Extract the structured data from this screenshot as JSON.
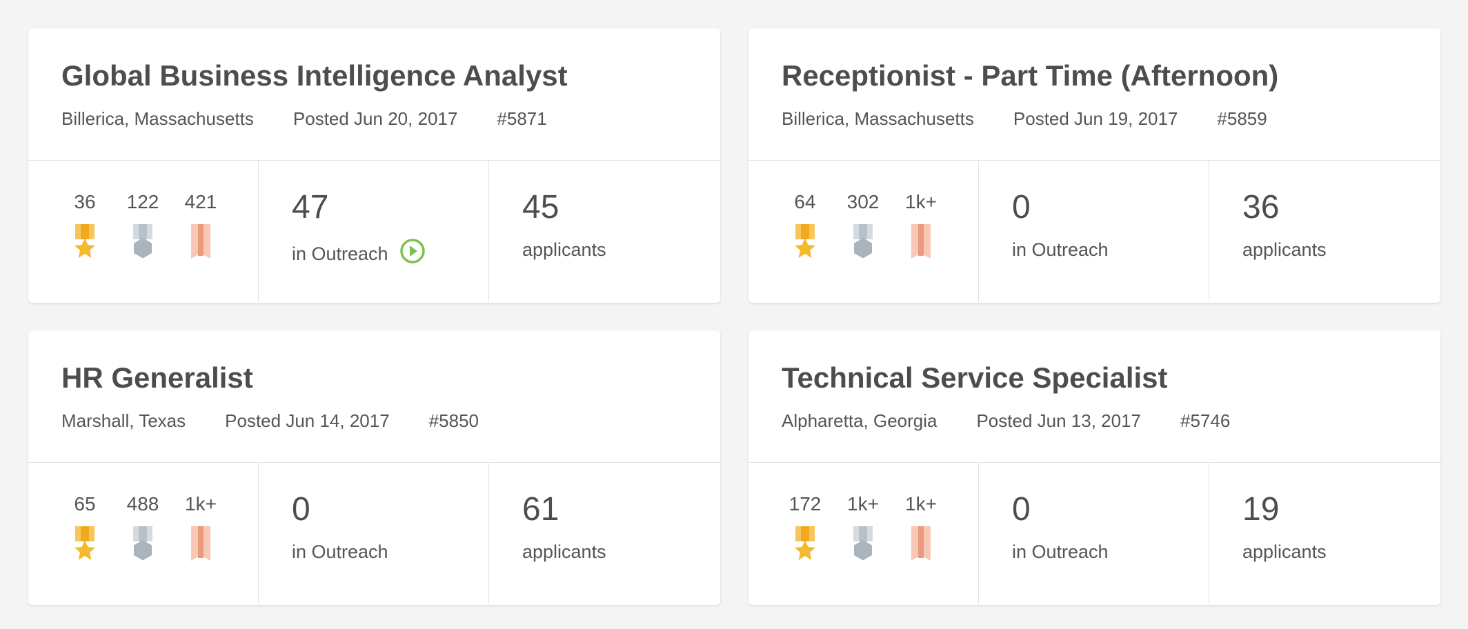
{
  "colors": {
    "background": "#f4f4f4",
    "card": "#ffffff",
    "gold": "#f5b92e",
    "silver": "#a9b4bd",
    "bronze": "#f0a990",
    "outreach_play": "#7cc14f"
  },
  "jobs": [
    {
      "title": "Global Business Intelligence Analyst",
      "location": "Billerica, Massachusetts",
      "posted": "Posted Jun 20, 2017",
      "id": "#5871",
      "medals": {
        "gold": "36",
        "silver": "122",
        "bronze": "421"
      },
      "outreach_count": "47",
      "outreach_label": "in Outreach",
      "outreach_active": true,
      "applicants_count": "45",
      "applicants_label": "applicants"
    },
    {
      "title": "Receptionist - Part Time (Afternoon)",
      "location": "Billerica, Massachusetts",
      "posted": "Posted Jun 19, 2017",
      "id": "#5859",
      "medals": {
        "gold": "64",
        "silver": "302",
        "bronze": "1k+"
      },
      "outreach_count": "0",
      "outreach_label": "in Outreach",
      "outreach_active": false,
      "applicants_count": "36",
      "applicants_label": "applicants"
    },
    {
      "title": "HR Generalist",
      "location": "Marshall, Texas",
      "posted": "Posted Jun 14, 2017",
      "id": "#5850",
      "medals": {
        "gold": "65",
        "silver": "488",
        "bronze": "1k+"
      },
      "outreach_count": "0",
      "outreach_label": "in Outreach",
      "outreach_active": false,
      "applicants_count": "61",
      "applicants_label": "applicants"
    },
    {
      "title": "Technical Service Specialist",
      "location": "Alpharetta, Georgia",
      "posted": "Posted Jun 13, 2017",
      "id": "#5746",
      "medals": {
        "gold": "172",
        "silver": "1k+",
        "bronze": "1k+"
      },
      "outreach_count": "0",
      "outreach_label": "in Outreach",
      "outreach_active": false,
      "applicants_count": "19",
      "applicants_label": "applicants"
    }
  ]
}
